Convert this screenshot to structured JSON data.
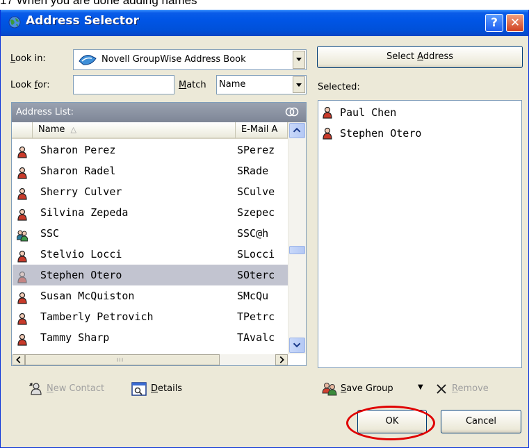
{
  "caption": "17  When you are done adding names",
  "window": {
    "title": "Address Selector",
    "help_glyph": "?",
    "close_glyph": "✕"
  },
  "look_in": {
    "label": "Look in:",
    "value": "Novell GroupWise Address Book"
  },
  "look_for": {
    "label": "Look for:",
    "value": ""
  },
  "match": {
    "label": "Match",
    "value": "Name"
  },
  "select_address_button": "Select Address",
  "selected_label": "Selected:",
  "address_list": {
    "header": "Address List:",
    "columns": [
      "Name",
      "E-Mail A"
    ],
    "sort_glyph": "△",
    "rows": [
      {
        "name": "Sharon Perez",
        "email": "SPerez",
        "type": "user",
        "selected": false
      },
      {
        "name": "Sharon Radel",
        "email": "SRade",
        "type": "user",
        "selected": false
      },
      {
        "name": "Sherry Culver",
        "email": "SCulve",
        "type": "user",
        "selected": false
      },
      {
        "name": "Silvina Zepeda",
        "email": "Szepec",
        "type": "user",
        "selected": false
      },
      {
        "name": "SSC",
        "email": "SSC@h",
        "type": "group",
        "selected": false
      },
      {
        "name": "Stelvio Locci",
        "email": "SLocci",
        "type": "user",
        "selected": false
      },
      {
        "name": "Stephen Otero",
        "email": "SOterc",
        "type": "user",
        "selected": true
      },
      {
        "name": "Susan McQuiston",
        "email": "SMcQu",
        "type": "user",
        "selected": false
      },
      {
        "name": "Tamberly Petrovich",
        "email": "TPetrc",
        "type": "user",
        "selected": false
      },
      {
        "name": "Tammy Sharp",
        "email": "TAvalc",
        "type": "user",
        "selected": false
      }
    ]
  },
  "selected_list": [
    {
      "name": "Paul Chen"
    },
    {
      "name": "Stephen Otero"
    }
  ],
  "actions": {
    "new_contact": "New Contact",
    "details": "Details",
    "save_group": "Save Group",
    "remove": "Remove"
  },
  "buttons": {
    "ok": "OK",
    "cancel": "Cancel"
  },
  "colors": {
    "annotation_circle": "#e00000",
    "title_bar": "#0055e5",
    "selection": "#c2c4d0"
  }
}
